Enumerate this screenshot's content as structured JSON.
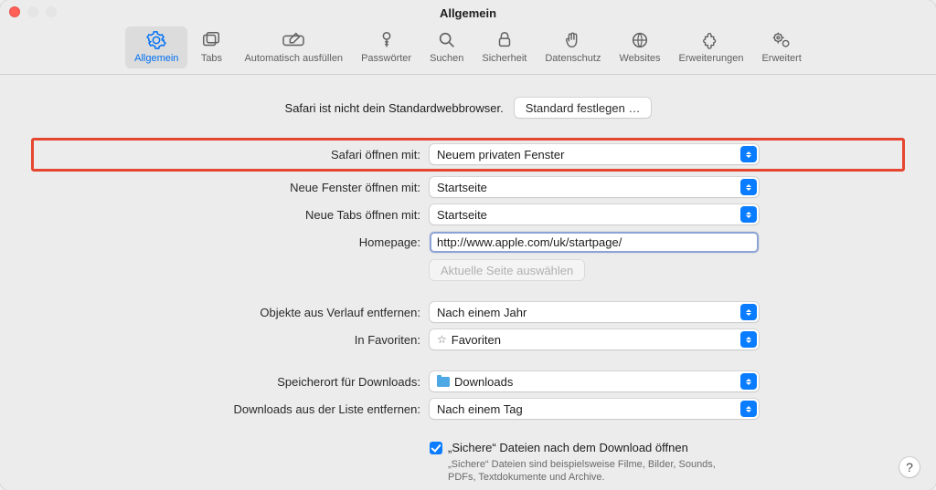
{
  "titlebar": {
    "title": "Allgemein"
  },
  "toolbar": {
    "items": [
      {
        "id": "general",
        "label": "Allgemein",
        "icon": "gear-icon",
        "active": true
      },
      {
        "id": "tabs",
        "label": "Tabs",
        "icon": "tabs-icon",
        "active": false
      },
      {
        "id": "autofill",
        "label": "Automatisch ausfüllen",
        "icon": "pencil-box-icon",
        "active": false
      },
      {
        "id": "passwords",
        "label": "Passwörter",
        "icon": "key-icon",
        "active": false
      },
      {
        "id": "search",
        "label": "Suchen",
        "icon": "magnify-icon",
        "active": false
      },
      {
        "id": "security",
        "label": "Sicherheit",
        "icon": "lock-icon",
        "active": false
      },
      {
        "id": "privacy",
        "label": "Datenschutz",
        "icon": "hand-icon",
        "active": false
      },
      {
        "id": "websites",
        "label": "Websites",
        "icon": "globe-icon",
        "active": false
      },
      {
        "id": "extensions",
        "label": "Erweiterungen",
        "icon": "puzzle-icon",
        "active": false
      },
      {
        "id": "advanced",
        "label": "Erweitert",
        "icon": "gears-icon",
        "active": false
      }
    ]
  },
  "defaults_row": {
    "text": "Safari ist nicht dein Standardwebbrowser.",
    "button": "Standard festlegen …"
  },
  "rows": {
    "open_with": {
      "label": "Safari öffnen mit:",
      "value": "Neuem privaten Fenster"
    },
    "new_windows": {
      "label": "Neue Fenster öffnen mit:",
      "value": "Startseite"
    },
    "new_tabs": {
      "label": "Neue Tabs öffnen mit:",
      "value": "Startseite"
    },
    "homepage": {
      "label": "Homepage:",
      "value": "http://www.apple.com/uk/startpage/"
    },
    "set_current": {
      "label": "Aktuelle Seite auswählen"
    },
    "remove_history": {
      "label": "Objekte aus Verlauf entfernen:",
      "value": "Nach einem Jahr"
    },
    "in_favorites": {
      "label": "In Favoriten:",
      "value": "Favoriten"
    },
    "downloads_loc": {
      "label": "Speicherort für Downloads:",
      "value": "Downloads"
    },
    "downloads_remove": {
      "label": "Downloads aus der Liste entfernen:",
      "value": "Nach einem Tag"
    }
  },
  "safe_files": {
    "checked": true,
    "label": "„Sichere“ Dateien nach dem Download öffnen",
    "sub": "„Sichere“ Dateien sind beispielsweise Filme, Bilder, Sounds, PDFs, Textdokumente und Archive."
  },
  "help": {
    "label": "?"
  }
}
